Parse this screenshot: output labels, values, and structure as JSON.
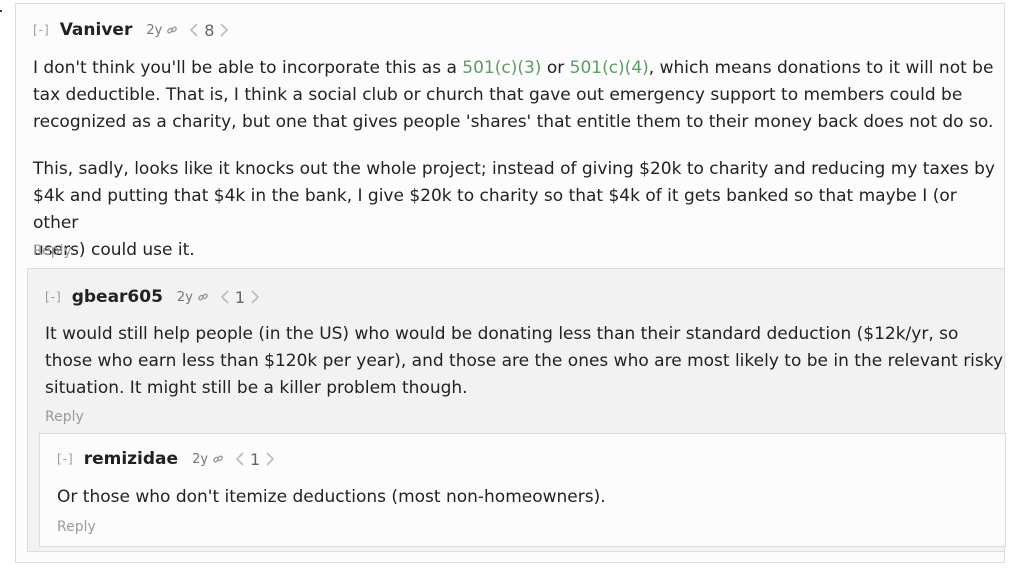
{
  "comments": [
    {
      "collapse_label": "[-]",
      "author": "Vaniver",
      "age": "2y",
      "karma": "8",
      "reply_label": "Reply",
      "p1_a": "I don't think you'll be able to incorporate this as a ",
      "link1": "501(c)(3)",
      "p1_b": " or ",
      "link2": "501(c)(4)",
      "p1_c": ", which means donations to it will not be",
      "p1_line2": "tax deductible. That is, I think a social club or church that gave out emergency support to members could be",
      "p1_line3": "recognized as a charity, but one that gives people 'shares' that entitle them to their money back does not do so.",
      "p2_line1": "This, sadly, looks like it knocks out the whole project; instead of giving $20k to charity and reducing my taxes by",
      "p2_line2": "$4k and putting that $4k in the bank, I give $20k to charity so that $4k of it gets banked so that maybe I (or other",
      "p2_line3": "users) could use it."
    },
    {
      "collapse_label": "[-]",
      "author": "gbear605",
      "age": "2y",
      "karma": "1",
      "reply_label": "Reply",
      "line1": "It would still help people (in the US) who would be donating less than their standard deduction ($12k/yr, so",
      "line2": "those who earn less than $120k per year), and those are the ones who are most likely to be in the relevant risky",
      "line3": "situation. It might still be a killer problem though."
    },
    {
      "collapse_label": "[-]",
      "author": "remizidae",
      "age": "2y",
      "karma": "1",
      "reply_label": "Reply",
      "line1": "Or those who don't itemize deductions (most non-homeowners)."
    }
  ],
  "colors": {
    "link": "#5f9b65",
    "text": "#222222",
    "muted": "#9a9a9a"
  }
}
